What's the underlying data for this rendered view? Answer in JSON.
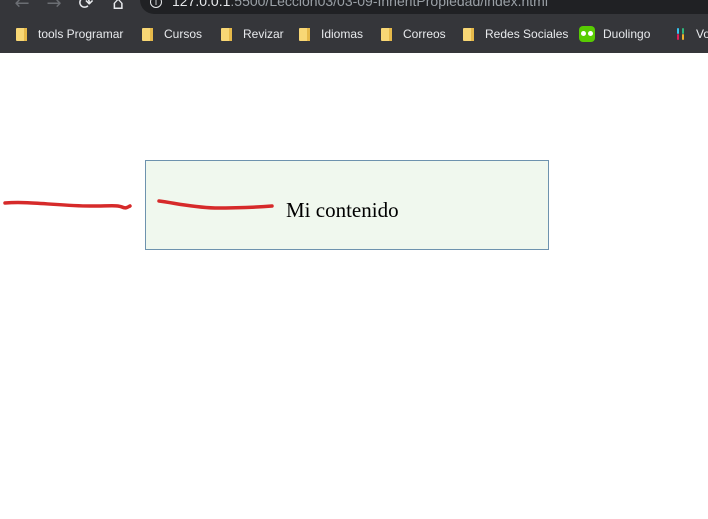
{
  "browser": {
    "url_host": "127.0.0.1",
    "url_path": ":5500/Leccion03/03-09-InheritPropiedad/index.html",
    "bookmarks": [
      {
        "label": "tools Programar",
        "icon": "folder-icon"
      },
      {
        "label": "Cursos",
        "icon": "folder-icon"
      },
      {
        "label": "Revizar",
        "icon": "folder-icon"
      },
      {
        "label": "Idiomas",
        "icon": "folder-icon"
      },
      {
        "label": "Correos",
        "icon": "folder-icon"
      },
      {
        "label": "Redes Sociales",
        "icon": "folder-icon"
      },
      {
        "label": "Duolingo",
        "icon": "duolingo-icon"
      },
      {
        "label": "Vo",
        "icon": "slack-icon"
      }
    ]
  },
  "page": {
    "content_text": "Mi contenido",
    "box_background": "#f0f8ee",
    "box_border": "#6e93ae",
    "annotation_color": "#d62a2a"
  }
}
